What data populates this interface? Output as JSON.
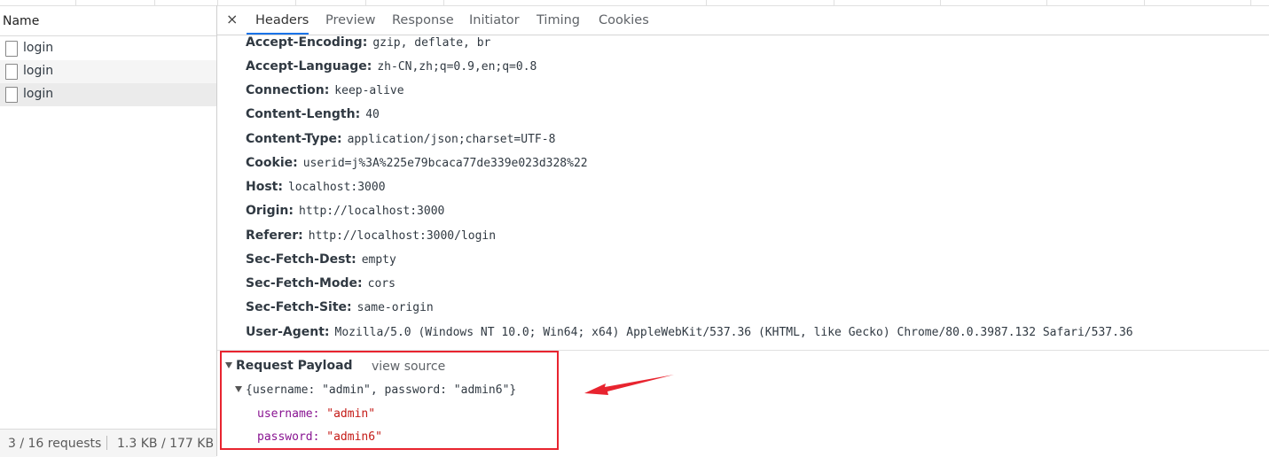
{
  "requests_panel": {
    "column_header": "Name",
    "items": [
      {
        "label": "login"
      },
      {
        "label": "login"
      },
      {
        "label": "login"
      }
    ],
    "status": {
      "request_count": "3 / 16 requests",
      "transfer": "1.3 KB / 177 KB t"
    }
  },
  "detail_panel": {
    "close_label": "×",
    "tabs": [
      "Headers",
      "Preview",
      "Response",
      "Initiator",
      "Timing",
      "Cookies"
    ],
    "active_tab": "Headers",
    "request_headers": [
      {
        "key": "Accept-Encoding:",
        "value": "gzip, deflate, br"
      },
      {
        "key": "Accept-Language:",
        "value": "zh-CN,zh;q=0.9,en;q=0.8"
      },
      {
        "key": "Connection:",
        "value": "keep-alive"
      },
      {
        "key": "Content-Length:",
        "value": "40"
      },
      {
        "key": "Content-Type:",
        "value": "application/json;charset=UTF-8"
      },
      {
        "key": "Cookie:",
        "value": "userid=j%3A%225e79bcaca77de339e023d328%22"
      },
      {
        "key": "Host:",
        "value": "localhost:3000"
      },
      {
        "key": "Origin:",
        "value": "http://localhost:3000"
      },
      {
        "key": "Referer:",
        "value": "http://localhost:3000/login"
      },
      {
        "key": "Sec-Fetch-Dest:",
        "value": "empty"
      },
      {
        "key": "Sec-Fetch-Mode:",
        "value": "cors"
      },
      {
        "key": "Sec-Fetch-Site:",
        "value": "same-origin"
      },
      {
        "key": "User-Agent:",
        "value": "Mozilla/5.0 (Windows NT 10.0; Win64; x64) AppleWebKit/537.36 (KHTML, like Gecko) Chrome/80.0.3987.132 Safari/537.36"
      }
    ],
    "payload": {
      "title": "Request Payload",
      "view_source": "view source",
      "object_summary": "{username: \"admin\", password: \"admin6\"}",
      "properties": [
        {
          "key": "username:",
          "value": "\"admin\""
        },
        {
          "key": "password:",
          "value": "\"admin6\""
        }
      ]
    }
  },
  "annotation": {
    "box_color": "#e8242f",
    "arrow_color": "#e8242f"
  },
  "colors": {
    "active_tab_underline": "#1a73e8",
    "property_key": "#881391",
    "string_value": "#c41a16"
  }
}
